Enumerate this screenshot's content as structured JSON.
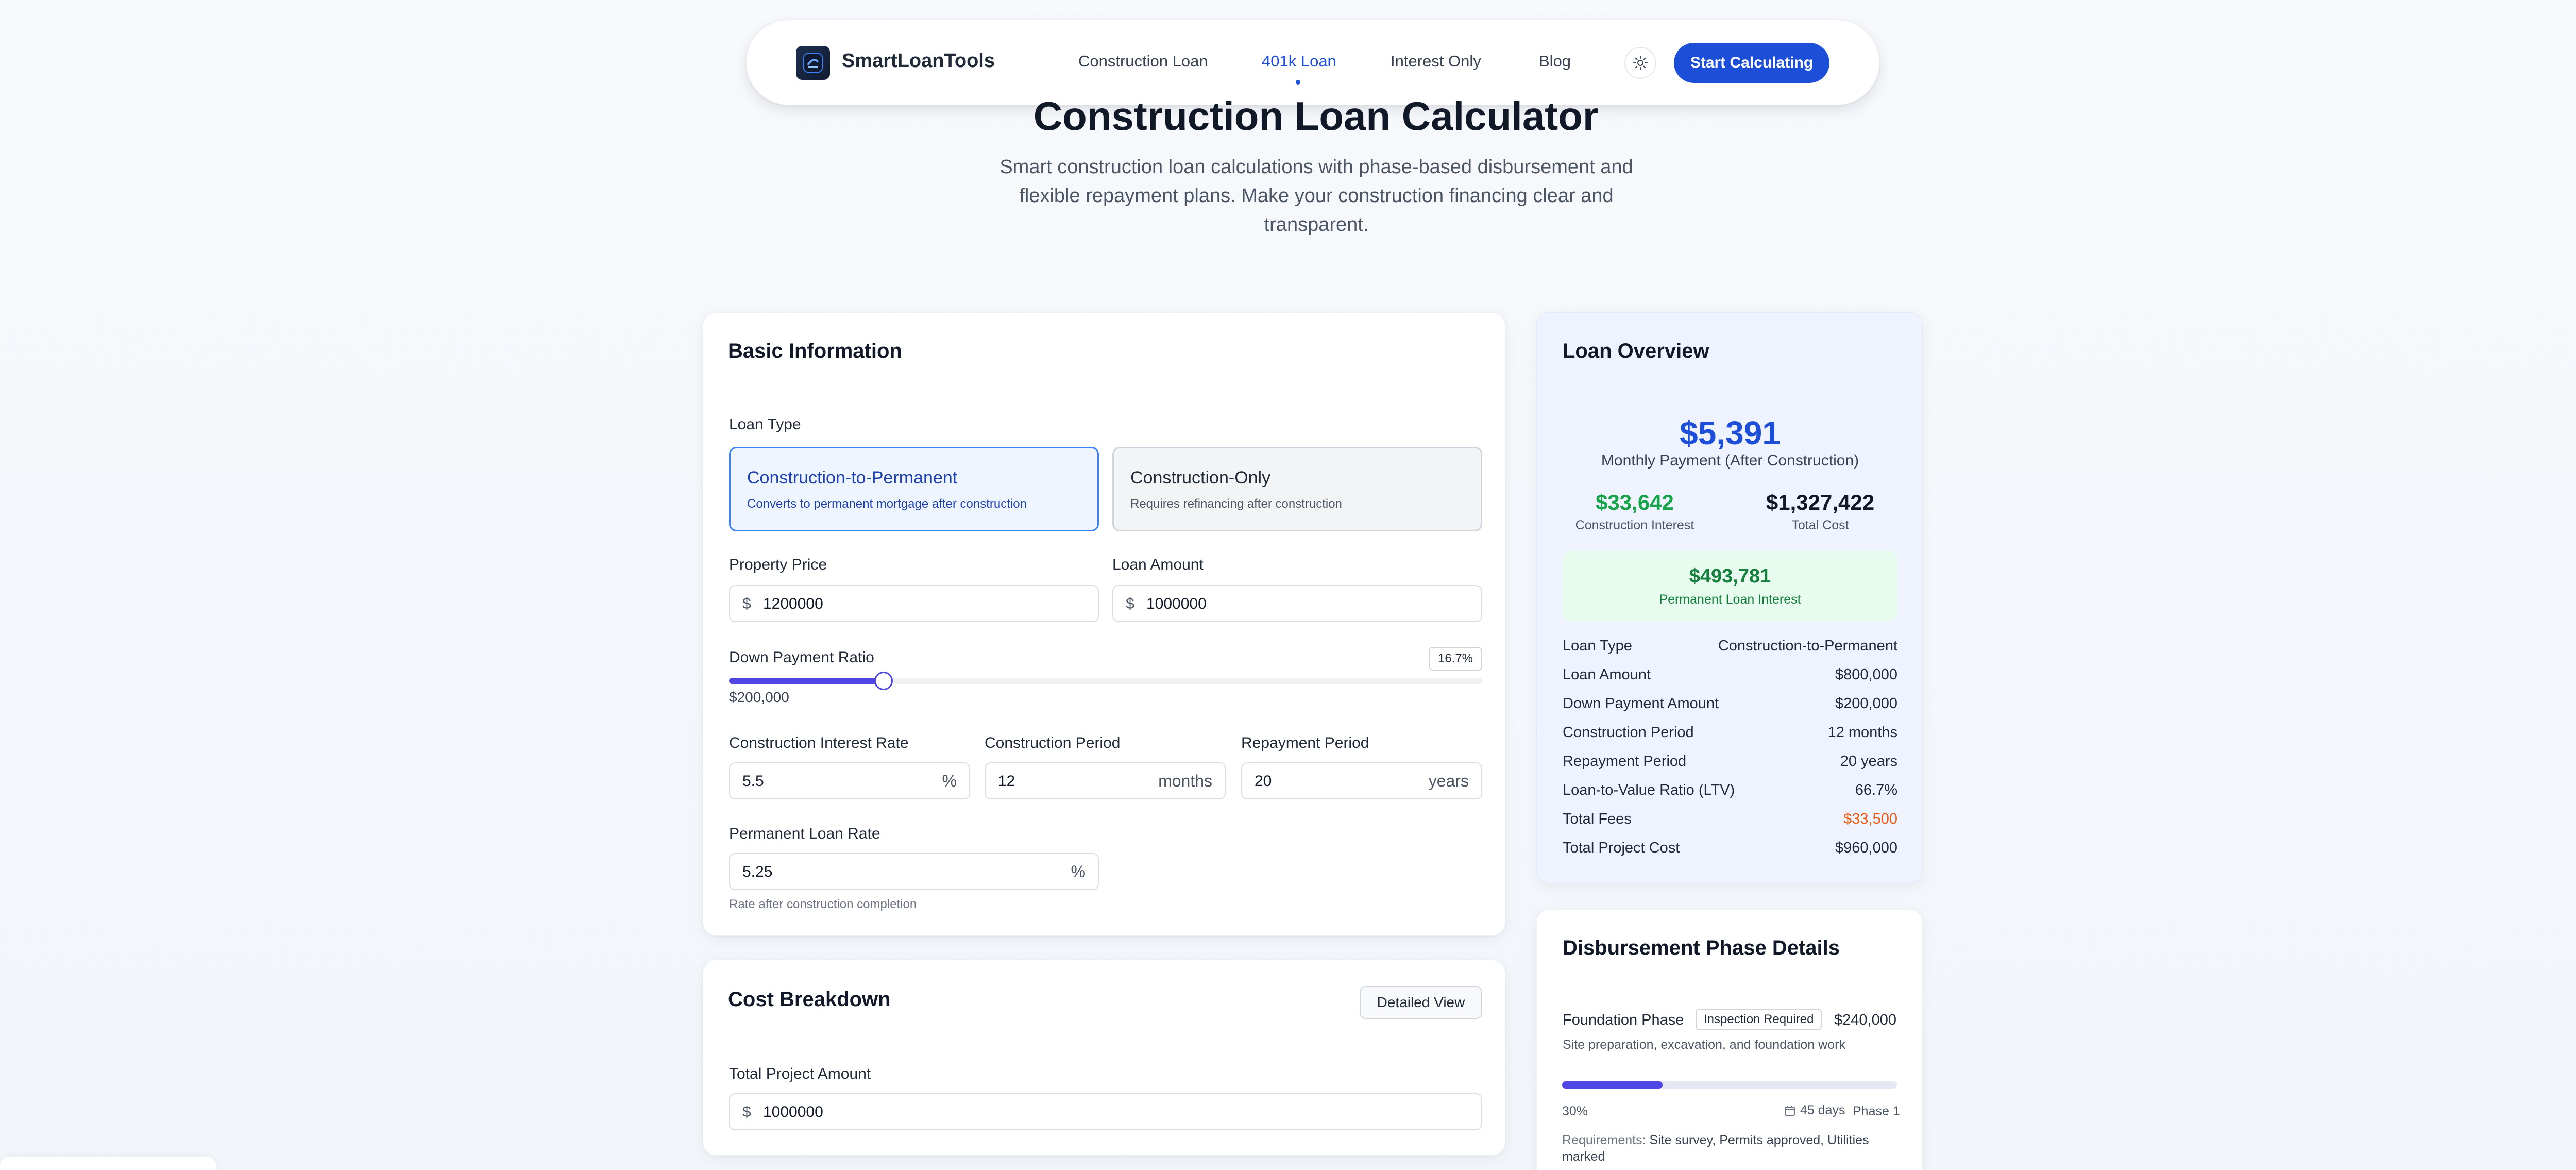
{
  "nav": {
    "brand": "SmartLoanTools",
    "links": [
      "Construction Loan",
      "401k Loan",
      "Interest Only",
      "Blog"
    ],
    "active_link": "401k Loan",
    "cta": "Start Calculating"
  },
  "hero": {
    "title": "Construction Loan Calculator",
    "subtitle": "Smart construction loan calculations with phase-based disbursement and flexible repayment plans. Make your construction financing clear and transparent."
  },
  "basic": {
    "title": "Basic Information",
    "loan_type_label": "Loan Type",
    "options": [
      {
        "title": "Construction-to-Permanent",
        "desc": "Converts to permanent mortgage after construction",
        "selected": true
      },
      {
        "title": "Construction-Only",
        "desc": "Requires refinancing after construction",
        "selected": false
      }
    ],
    "property_price": {
      "label": "Property Price",
      "prefix": "$",
      "value": "1200000"
    },
    "loan_amount": {
      "label": "Loan Amount",
      "prefix": "$",
      "value": "1000000"
    },
    "down_payment": {
      "label": "Down Payment Ratio",
      "percent": "16.7%",
      "amount": "$200,000",
      "fill_fraction": 0.205
    },
    "construction_rate": {
      "label": "Construction Interest Rate",
      "value": "5.5",
      "suffix": "%"
    },
    "construction_period": {
      "label": "Construction Period",
      "value": "12",
      "suffix": "months"
    },
    "repayment_period": {
      "label": "Repayment Period",
      "value": "20",
      "suffix": "years"
    },
    "permanent_rate": {
      "label": "Permanent Loan Rate",
      "value": "5.25",
      "suffix": "%",
      "hint": "Rate after construction completion"
    }
  },
  "cost": {
    "title": "Cost Breakdown",
    "detail_button": "Detailed View",
    "total_label": "Total Project Amount",
    "total_prefix": "$",
    "total_value": "1000000"
  },
  "overview": {
    "title": "Loan Overview",
    "monthly_payment": "$5,391",
    "monthly_label": "Monthly Payment (After Construction)",
    "construction_interest": "$33,642",
    "construction_interest_label": "Construction Interest",
    "total_cost": "$1,327,422",
    "total_cost_label": "Total Cost",
    "permanent_interest": "$493,781",
    "permanent_interest_label": "Permanent Loan Interest",
    "rows": [
      {
        "k": "Loan Type",
        "v": "Construction-to-Permanent"
      },
      {
        "k": "Loan Amount",
        "v": "$800,000"
      },
      {
        "k": "Down Payment Amount",
        "v": "$200,000"
      },
      {
        "k": "Construction Period",
        "v": "12 months"
      },
      {
        "k": "Repayment Period",
        "v": "20 years"
      },
      {
        "k": "Loan-to-Value Ratio (LTV)",
        "v": "66.7%"
      },
      {
        "k": "Total Fees",
        "v": "$33,500"
      },
      {
        "k": "Total Project Cost",
        "v": "$960,000"
      }
    ],
    "colors": {
      "primary": "#1d4ed8",
      "positive": "#16a34a",
      "warning": "#ea580c"
    }
  },
  "phases": {
    "title": "Disbursement Phase Details",
    "phase": {
      "name": "Foundation Phase",
      "badge": "Inspection Required",
      "amount": "$240,000",
      "desc": "Site preparation, excavation, and foundation work",
      "percent": "30%",
      "progress_fraction": 0.3,
      "days": "45 days",
      "phase_no": "Phase 1",
      "req_label": "Requirements:",
      "requirements": "Site survey, Permits approved, Utilities marked"
    }
  },
  "icons": [
    "logo-icon",
    "sun-icon",
    "calendar-icon",
    "grid-icon",
    "translate-icon"
  ]
}
